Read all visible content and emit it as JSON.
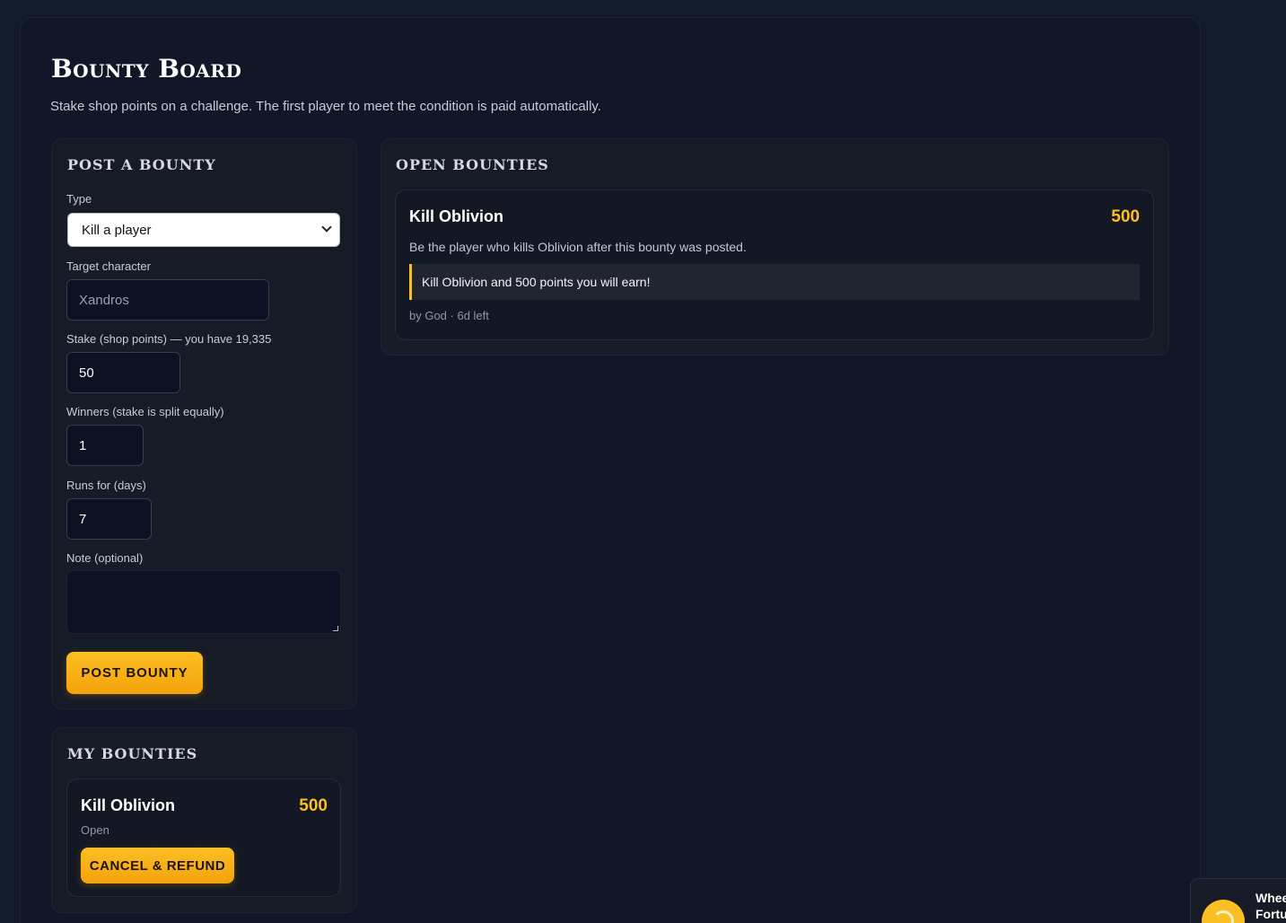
{
  "header": {
    "title": "Bounty Board",
    "subtitle": "Stake shop points on a challenge. The first player to meet the condition is paid automatically."
  },
  "post_form": {
    "heading": "POST A BOUNTY",
    "type_label": "Type",
    "type_value": "Kill a player",
    "target_label": "Target character",
    "target_placeholder": "Xandros",
    "stake_label": "Stake (shop points) — you have 19,335",
    "stake_value": "50",
    "winners_label": "Winners (stake is split equally)",
    "winners_value": "1",
    "runs_label": "Runs for (days)",
    "runs_value": "7",
    "note_label": "Note (optional)",
    "note_value": "",
    "submit_label": "POST BOUNTY"
  },
  "my_bounties": {
    "heading": "MY BOUNTIES",
    "items": [
      {
        "title": "Kill Oblivion",
        "amount": "500",
        "status": "Open",
        "action_label": "CANCEL & REFUND"
      }
    ]
  },
  "open_bounties": {
    "heading": "OPEN BOUNTIES",
    "items": [
      {
        "title": "Kill Oblivion",
        "amount": "500",
        "description": "Be the player who kills Oblivion after this bounty was posted.",
        "note": "Kill Oblivion and 500 points you will earn!",
        "meta": "by God · 6d left"
      }
    ]
  },
  "widget": {
    "label": "Whee\nFortu",
    "icon": "wheel-icon"
  },
  "colors": {
    "accent": "#fbbf24",
    "background": "#131a2c",
    "panel": "#171b26"
  }
}
